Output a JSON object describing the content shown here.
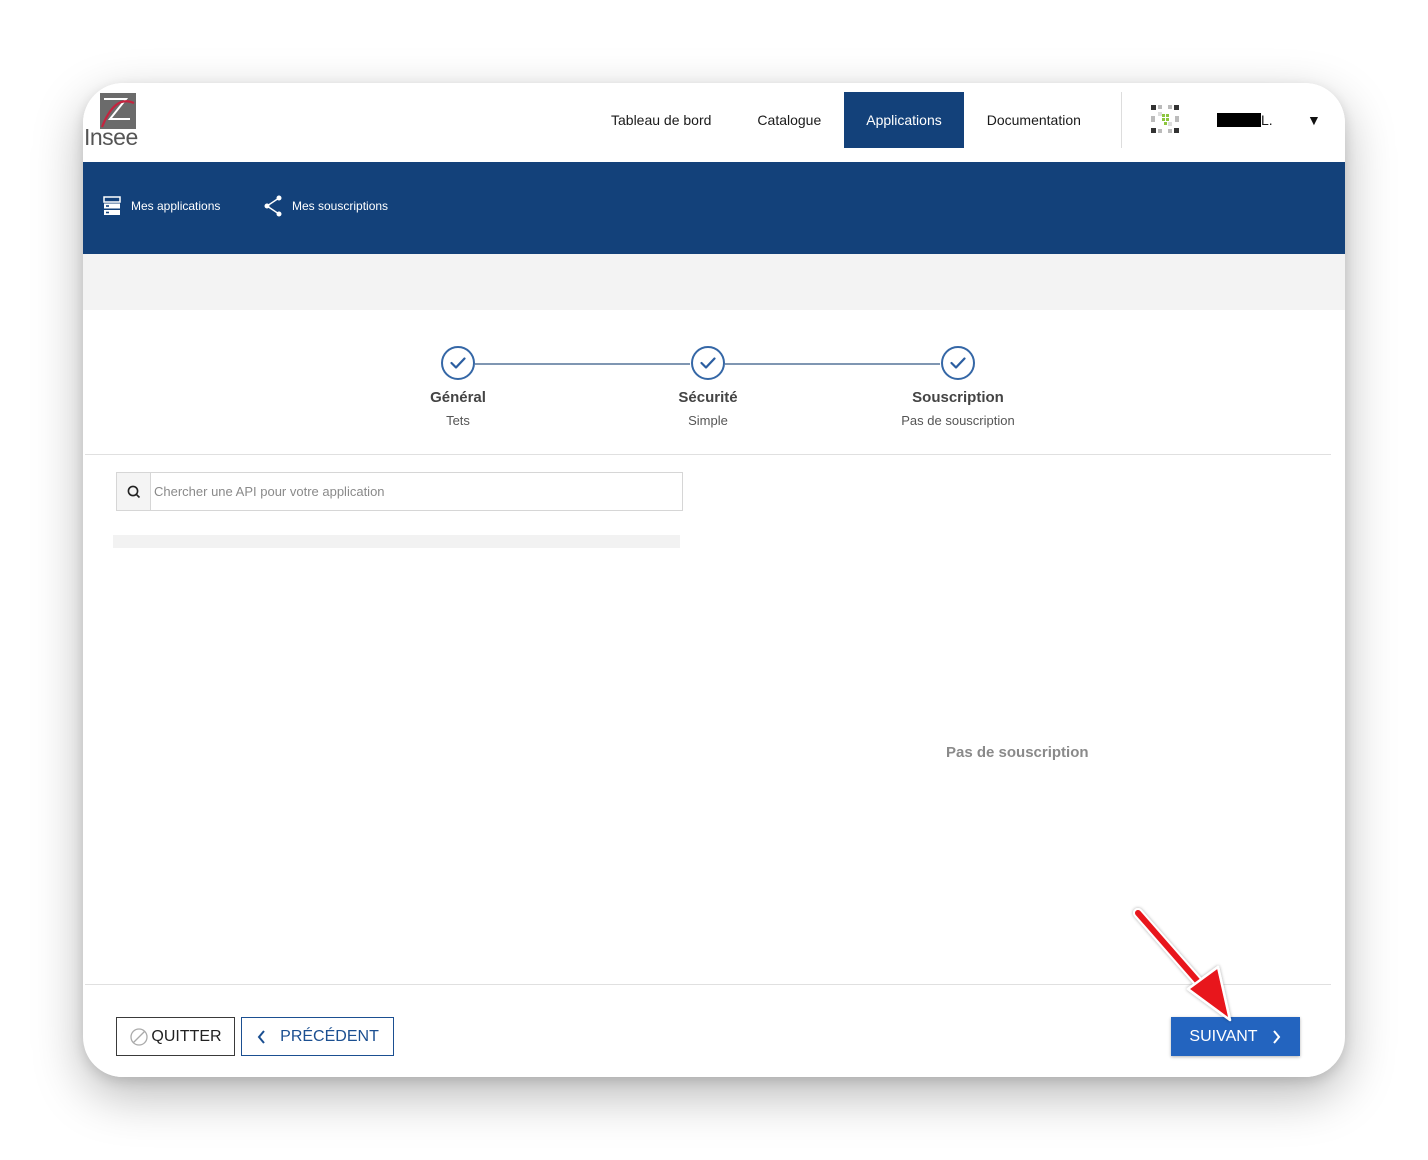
{
  "header": {
    "logo_text": "Insee",
    "nav": [
      {
        "label": "Tableau de bord",
        "active": false
      },
      {
        "label": "Catalogue",
        "active": false
      },
      {
        "label": "Applications",
        "active": true
      },
      {
        "label": "Documentation",
        "active": false
      }
    ],
    "user_name_suffix": "L.",
    "colors": {
      "primary": "#13417a",
      "accent": "#2364bf"
    }
  },
  "subnav": {
    "items": [
      {
        "label": "Mes applications",
        "icon": "server-icon"
      },
      {
        "label": "Mes souscriptions",
        "icon": "share-icon"
      }
    ]
  },
  "stepper": {
    "steps": [
      {
        "title": "Général",
        "subtitle": "Tets",
        "done": true
      },
      {
        "title": "Sécurité",
        "subtitle": "Simple",
        "done": true
      },
      {
        "title": "Souscription",
        "subtitle": "Pas de souscription",
        "done": true
      }
    ]
  },
  "search": {
    "placeholder": "Chercher une API pour votre application",
    "value": ""
  },
  "subscriptions": {
    "empty_message": "Pas de souscription"
  },
  "footer": {
    "quit_label": "QUITTER",
    "prev_label": "PRÉCÉDENT",
    "next_label": "SUIVANT"
  }
}
